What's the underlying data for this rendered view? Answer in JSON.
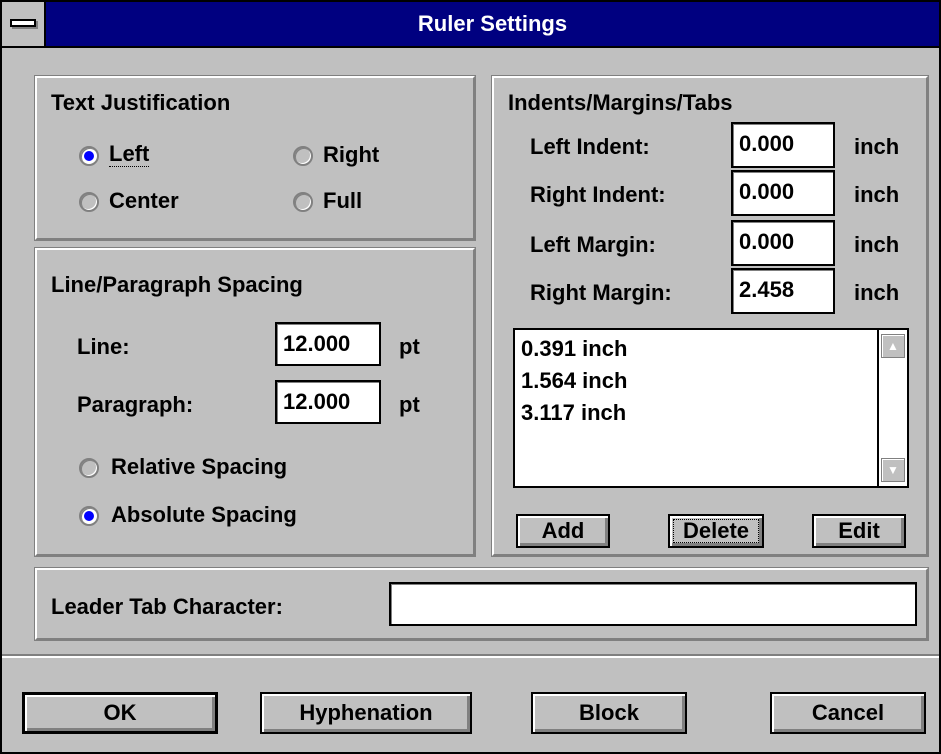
{
  "window": {
    "title": "Ruler Settings"
  },
  "text_justification": {
    "heading": "Text Justification",
    "options": [
      {
        "label": "Left",
        "selected": true
      },
      {
        "label": "Right",
        "selected": false
      },
      {
        "label": "Center",
        "selected": false
      },
      {
        "label": "Full",
        "selected": false
      }
    ]
  },
  "spacing": {
    "heading": "Line/Paragraph Spacing",
    "line_label": "Line:",
    "line_value": "12.000",
    "line_unit": "pt",
    "paragraph_label": "Paragraph:",
    "paragraph_value": "12.000",
    "paragraph_unit": "pt",
    "options": [
      {
        "label": "Relative Spacing",
        "selected": false
      },
      {
        "label": "Absolute Spacing",
        "selected": true
      }
    ]
  },
  "indents": {
    "heading": "Indents/Margins/Tabs",
    "fields": [
      {
        "label": "Left Indent:",
        "value": "0.000",
        "unit": "inch"
      },
      {
        "label": "Right Indent:",
        "value": "0.000",
        "unit": "inch"
      },
      {
        "label": "Left Margin:",
        "value": "0.000",
        "unit": "inch"
      },
      {
        "label": "Right Margin:",
        "value": "2.458",
        "unit": "inch"
      }
    ],
    "tabs": [
      "0.391 inch",
      "1.564 inch",
      "3.117 inch"
    ],
    "scroll_up_icon": "up-arrow-icon",
    "scroll_down_icon": "down-arrow-icon",
    "add_label": "Add",
    "delete_label": "Delete",
    "edit_label": "Edit"
  },
  "leader": {
    "label": "Leader Tab Character:",
    "value": ""
  },
  "buttons": {
    "ok": "OK",
    "hyphenation": "Hyphenation",
    "block": "Block",
    "cancel": "Cancel"
  },
  "colors": {
    "titlebar": "#000080",
    "face": "#c0c0c0",
    "radio_dot": "#0000ff"
  }
}
